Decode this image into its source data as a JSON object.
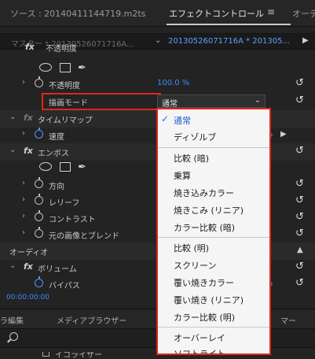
{
  "tabs": {
    "source": "ソース : 20140411144719.m2ts",
    "effect": "エフェクトコントロール",
    "menu_icon": "≡",
    "overflow": "オーデ"
  },
  "master": {
    "left": "マスター * 20130526071716A...",
    "right": "20130526071716A * 201305..."
  },
  "effects": {
    "opacity_header": "不透明度",
    "opacity_label": "不透明度",
    "opacity_value": "100.0 %",
    "blend_label": "描画モード",
    "blend_value": "通常",
    "timeremap_label": "タイムリマップ",
    "speed_label": "速度",
    "emboss_label": "エンボス",
    "direction_label": "方向",
    "relief_label": "レリーフ",
    "contrast_label": "コントラスト",
    "blend_original_label": "元の画像とブレンド",
    "audio_label": "オーディオ",
    "volume_label": "ボリューム",
    "bypass_label": "バイパス"
  },
  "timecode": "00:00:00:00",
  "bottom_tabs": {
    "edit": "ラ編集",
    "media_browser": "メディアブラウザー",
    "marker": "マー"
  },
  "partial_item": "イコライザー",
  "dropdown": {
    "selected": "通常",
    "items": [
      "通常",
      "ディゾルブ",
      "比較 (暗)",
      "乗算",
      "焼き込みカラー",
      "焼きこみ (リニア)",
      "カラー比較 (暗)",
      "比較 (明)",
      "スクリーン",
      "覆い焼きカラー",
      "覆い焼き (リニア)",
      "カラー比較 (明)",
      "オーバーレイ",
      "ソフトライト"
    ]
  },
  "colors": {
    "highlight_border": "#e0261a",
    "accent_blue": "#4e96ff"
  }
}
